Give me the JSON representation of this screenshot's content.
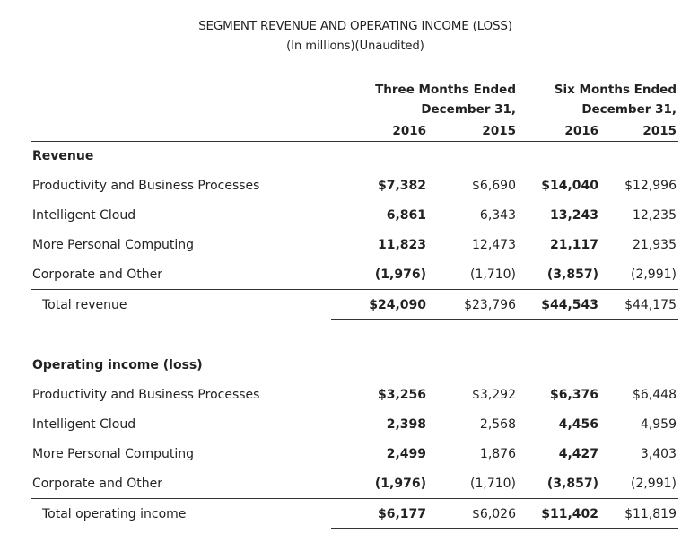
{
  "title": "SEGMENT REVENUE AND OPERATING INCOME (LOSS)",
  "subtitle": "(In millions)(Unaudited)",
  "headers": {
    "three_months_line1": "Three Months Ended",
    "three_months_line2": "December 31,",
    "six_months_line1": "Six Months Ended",
    "six_months_line2": "December 31,",
    "years": [
      "2016",
      "2015",
      "2016",
      "2015"
    ]
  },
  "revenue": {
    "section_label": "Revenue",
    "rows": [
      {
        "label": "Productivity and Business Processes",
        "values": [
          "$7,382",
          "$6,690",
          "$14,040",
          "$12,996"
        ]
      },
      {
        "label": "Intelligent Cloud",
        "values": [
          "6,861",
          "6,343",
          "13,243",
          "12,235"
        ]
      },
      {
        "label": "More Personal Computing",
        "values": [
          "11,823",
          "12,473",
          "21,117",
          "21,935"
        ]
      },
      {
        "label": "Corporate and Other",
        "values": [
          "(1,976)",
          "(1,710)",
          "(3,857)",
          "(2,991)"
        ]
      }
    ],
    "total": {
      "label": "Total revenue",
      "values": [
        "$24,090",
        "$23,796",
        "$44,543",
        "$44,175"
      ]
    }
  },
  "operating_income": {
    "section_label": "Operating income (loss)",
    "rows": [
      {
        "label": "Productivity and Business Processes",
        "values": [
          "$3,256",
          "$3,292",
          "$6,376",
          "$6,448"
        ]
      },
      {
        "label": "Intelligent Cloud",
        "values": [
          "2,398",
          "2,568",
          "4,456",
          "4,959"
        ]
      },
      {
        "label": "More Personal Computing",
        "values": [
          "2,499",
          "1,876",
          "4,427",
          "3,403"
        ]
      },
      {
        "label": "Corporate and Other",
        "values": [
          "(1,976)",
          "(1,710)",
          "(3,857)",
          "(2,991)"
        ]
      }
    ],
    "total": {
      "label": "Total operating income",
      "values": [
        "$6,177",
        "$6,026",
        "$11,402",
        "$11,819"
      ]
    }
  }
}
